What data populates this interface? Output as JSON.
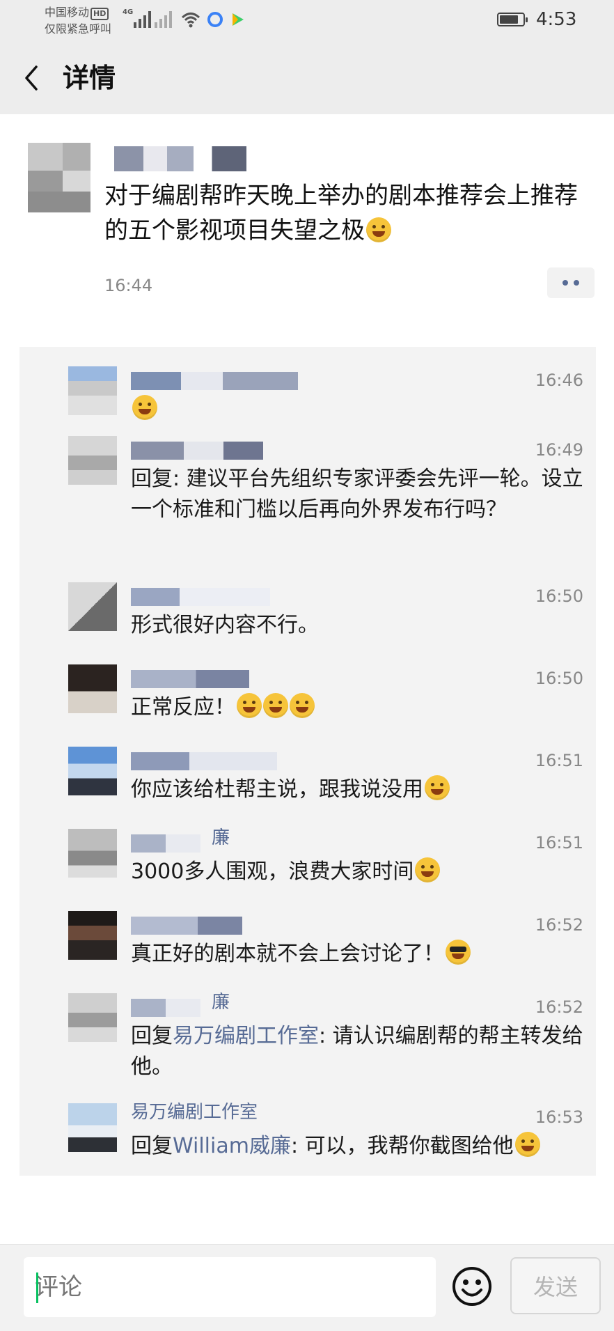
{
  "status_bar": {
    "carrier_line1": "中国移动",
    "carrier_badge": "HD",
    "carrier_line2": "仅限紧急呼叫",
    "network": "4G",
    "time": "4:53",
    "battery_level": 0.8
  },
  "nav": {
    "title": "详情"
  },
  "post": {
    "text": "对于编剧帮昨天晚上举办的剧本推荐会上推荐的五个影视项目失望之极",
    "time": "16:44"
  },
  "comments": [
    {
      "time": "16:46",
      "text": "",
      "emojis": [
        "tears-of-joy-emoji"
      ]
    },
    {
      "time": "16:49",
      "text": "回复: 建议平台先组织专家评委会先评一轮。设立一个标准和门槛以后再向外界发布行吗？",
      "emojis": []
    },
    {
      "time": "16:50",
      "text": "形式很好内容不行。",
      "emojis": []
    },
    {
      "time": "16:50",
      "text": "正常反应！",
      "emojis": [
        "thinking-emoji",
        "thinking-emoji",
        "thinking-emoji"
      ]
    },
    {
      "time": "16:51",
      "text": "你应该给杜帮主说，跟我说没用",
      "emojis": [
        "grin-emoji"
      ]
    },
    {
      "time": "16:51",
      "name": "廉",
      "text": "3000多人围观，浪费大家时间",
      "emojis": [
        "sweat-laugh-emoji"
      ]
    },
    {
      "time": "16:52",
      "text": "真正好的剧本就不会上会讨论了！",
      "emojis": [
        "sunglasses-emoji"
      ]
    },
    {
      "time": "16:52",
      "name": "廉",
      "reply_prefix": "回复",
      "reply_target": "易万编剧工作室",
      "reply_text": ": 请认识编剧帮的帮主转发给他。",
      "emojis": []
    },
    {
      "time": "16:53",
      "name": "易万编剧工作室",
      "reply_prefix": "回复",
      "reply_target": "William威廉",
      "reply_text": ": 可以，我帮你截图给他",
      "emojis": [
        "grin-emoji"
      ]
    }
  ],
  "input": {
    "placeholder": "评论",
    "send_label": "发送"
  }
}
